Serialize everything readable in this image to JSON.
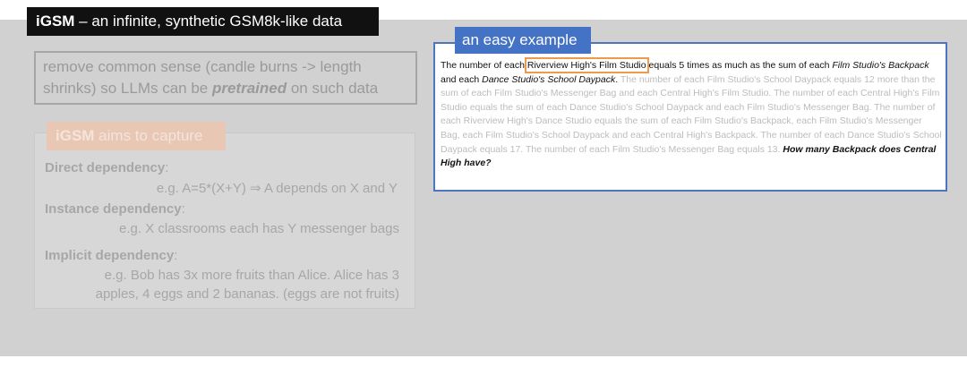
{
  "header": {
    "title_brand": "iGSM",
    "title_rest": " – an infinite, synthetic GSM8k-like data"
  },
  "left": {
    "common_sense_pre": "remove common sense (candle burns -> length shrinks) so LLMs can be ",
    "common_sense_em": "pretrained",
    "common_sense_post": " on such data",
    "capture_brand": "iGSM",
    "capture_rest": " aims to capture",
    "dependencies": [
      {
        "head": "Direct dependency",
        "colon": ":",
        "example": "e.g. A=5*(X+Y) ⇒ A depends on X and Y"
      },
      {
        "head": "Instance dependency",
        "colon": ":",
        "example": "e.g. X classrooms each has Y messenger bags"
      },
      {
        "head": "Implicit dependency",
        "colon": ":",
        "example_line1": "e.g. Bob has 3x more fruits than Alice. Alice has 3",
        "example_line2": "apples, 4 eggs and 2 bananas. (eggs are not fruits)"
      }
    ]
  },
  "example": {
    "tab_label": "an easy example",
    "s1_a": "The number of each ",
    "s1_boxed": "Riverview High's Film Studio",
    "s1_b": " equals 5 times as much as the sum of each ",
    "s1_it1": "Film Studio's Backpack",
    "s1_c": " and each ",
    "s1_it2": "Dance Studio's School Daypack",
    "s1_d": ".",
    "faded": " The number of each Film Studio's School Daypack equals 12 more than the sum of each Film Studio's Messenger Bag and each Central High's Film Studio. The number of each Central High's Film Studio equals the sum of each Dance Studio's School Daypack and each Film Studio's Messenger Bag. The number of each Riverview High's Dance Studio equals the sum of each Film Studio's Backpack, each Film Studio's Messenger Bag, each Film Studio's School Daypack and each Central High's Backpack. The number of each Dance Studio's School Daypack equals 17. The number of each Film Studio's Messenger Bag equals 13. ",
    "question": "How many Backpack does Central High have?"
  }
}
